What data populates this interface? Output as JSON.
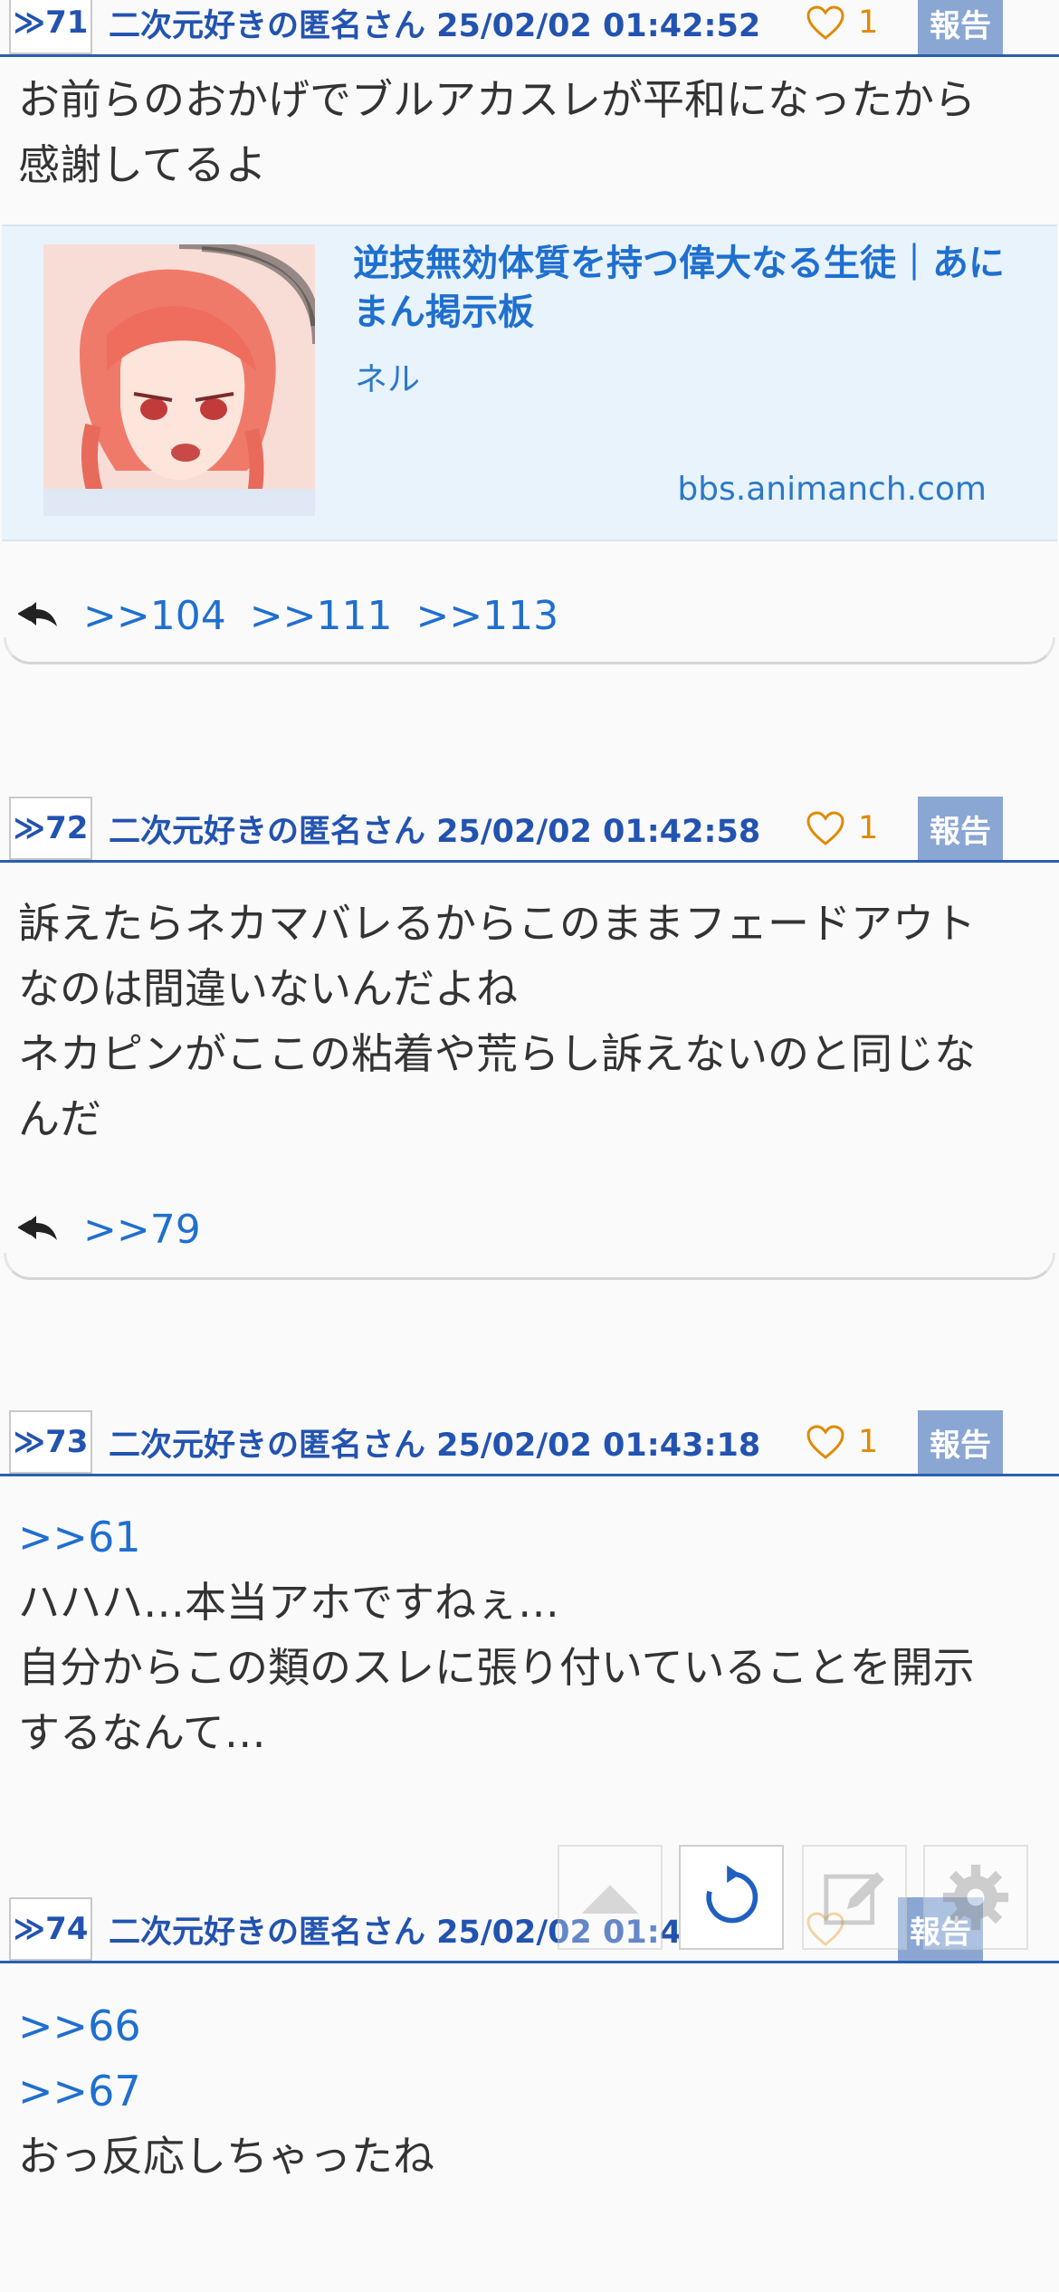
{
  "posts": [
    {
      "num_label": "≫71",
      "meta": "二次元好きの匿名さん 25/02/02 01:42:52",
      "likes": "1",
      "report_label": "報告",
      "body_lines": [
        "お前らのおかげでブルアカスレが平和になったから",
        "感謝してるよ"
      ],
      "link_card": {
        "title_line1": "逆技無効体質を持つ偉大なる生徒｜あに",
        "title_line2": "まん掲示板",
        "description": "ネル",
        "domain": "bbs.animanch.com"
      },
      "replies": [
        ">>104",
        ">>111",
        ">>113"
      ]
    },
    {
      "num_label": "≫72",
      "meta": "二次元好きの匿名さん 25/02/02 01:42:58",
      "likes": "1",
      "report_label": "報告",
      "body_lines": [
        "訴えたらネカマバレるからこのままフェードアウト",
        "なのは間違いないんだよね",
        "ネカピンがここの粘着や荒らし訴えないのと同じな",
        "んだ"
      ],
      "replies": [
        ">>79"
      ]
    },
    {
      "num_label": "≫73",
      "meta": "二次元好きの匿名さん 25/02/02 01:43:18",
      "likes": "1",
      "report_label": "報告",
      "anchor_lines": [
        ">>61"
      ],
      "body_lines": [
        "ハハハ…本当アホですねぇ…",
        "自分からこの類のスレに張り付いていることを開示",
        "するなんて…"
      ]
    },
    {
      "num_label": "≫74",
      "meta": "二次元好きの匿名さん 25/02/02 01:4",
      "report_label": "報告",
      "anchor_lines": [
        ">>66",
        ">>67"
      ],
      "body_lines": [
        "おっ反応しちゃったね"
      ]
    }
  ],
  "floating_toolbar": {
    "icons": [
      "scroll-top-icon",
      "refresh-icon",
      "edit-icon",
      "settings-icon"
    ]
  },
  "colors": {
    "accent": "#2253b0",
    "link": "#1f6fcf",
    "like": "#e08a00",
    "report_bg": "#8aa6d3",
    "card_bg": "#e8f3fc"
  }
}
